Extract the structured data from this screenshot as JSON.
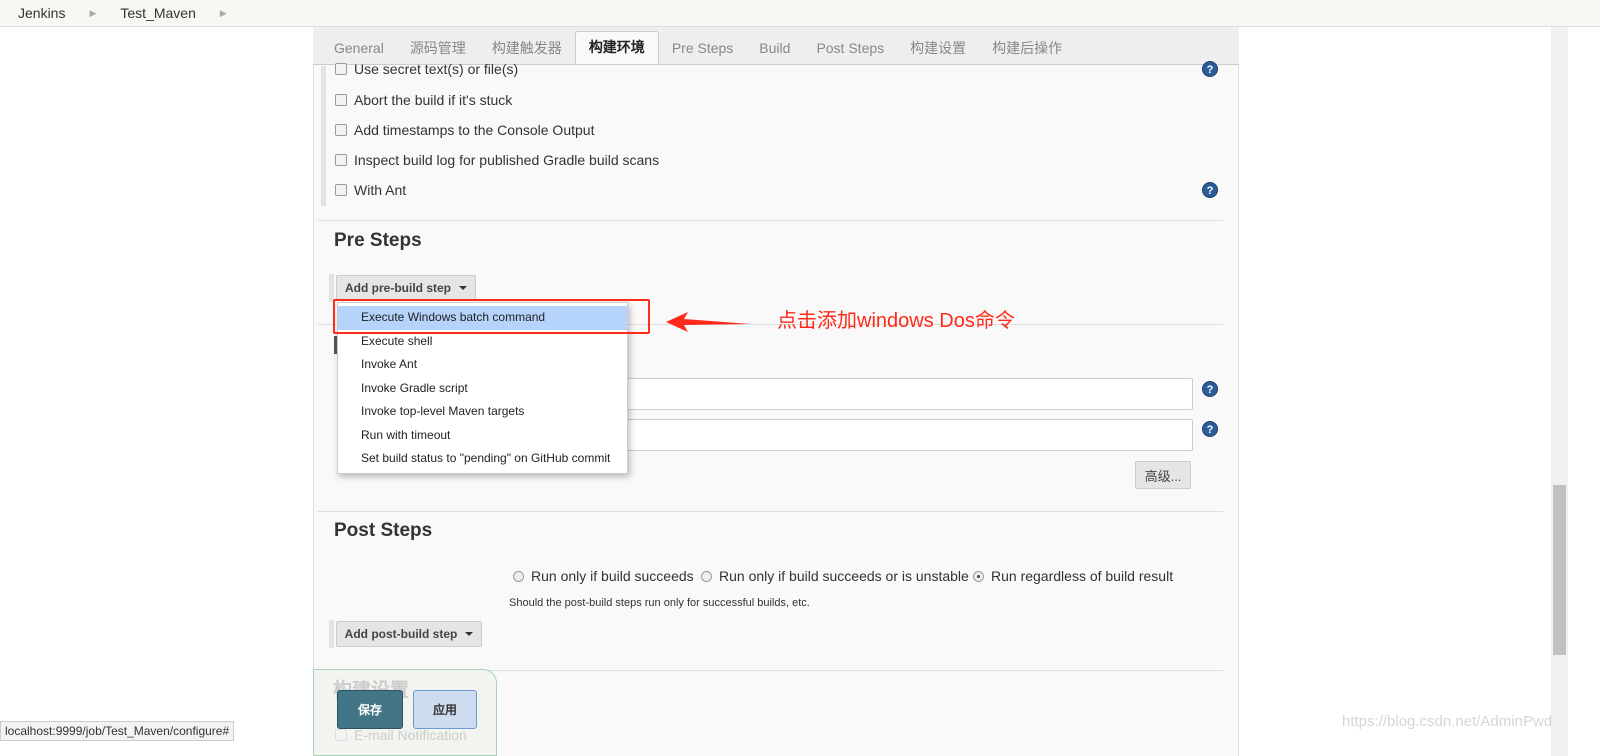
{
  "breadcrumb": [
    "Jenkins",
    "Test_Maven"
  ],
  "tabs": [
    "General",
    "源码管理",
    "构建触发器",
    "构建环境",
    "Pre Steps",
    "Build",
    "Post Steps",
    "构建设置",
    "构建后操作"
  ],
  "active_tab": "构建环境",
  "build_env": {
    "options": [
      "Use secret text(s) or file(s)",
      "Abort the build if it's stuck",
      "Add timestamps to the Console Output",
      "Inspect build log for published Gradle build scans",
      "With Ant"
    ]
  },
  "pre_steps": {
    "title": "Pre Steps",
    "add_button": "Add pre-build step",
    "menu": [
      "Execute Windows batch command",
      "Execute shell",
      "Invoke Ant",
      "Invoke Gradle script",
      "Invoke top-level Maven targets",
      "Run with timeout",
      "Set build status to \"pending\" on GitHub commit"
    ],
    "highlighted": "Execute Windows batch command"
  },
  "annotation": {
    "text": "点击添加windows Dos命令",
    "color": "#ff2a1a"
  },
  "build": {
    "advanced_button": "高级..."
  },
  "post_steps": {
    "title": "Post Steps",
    "options": [
      "Run only if build succeeds",
      "Run only if build succeeds or is unstable",
      "Run regardless of build result"
    ],
    "selected": "Run regardless of build result",
    "hint": "Should the post-build steps run only for successful builds, etc.",
    "add_button": "Add post-build step"
  },
  "build_settings": {
    "title": "构建设置",
    "option": "E-mail Notification"
  },
  "footer": {
    "save": "保存",
    "apply": "应用"
  },
  "status_url": "localhost:9999/job/Test_Maven/configure#",
  "watermark": "https://blog.csdn.net/AdminPwd"
}
